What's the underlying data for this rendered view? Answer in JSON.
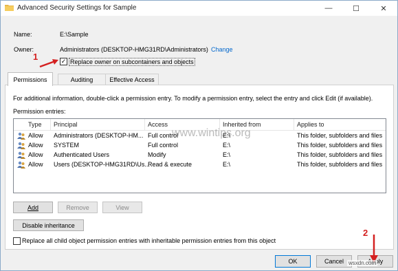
{
  "window": {
    "title": "Advanced Security Settings for Sample",
    "controls": {
      "minimize": "—",
      "maximize": "☐",
      "close": "✕"
    }
  },
  "info": {
    "name_label": "Name:",
    "name_value": "E:\\Sample",
    "owner_label": "Owner:",
    "owner_value": "Administrators (DESKTOP-HMG31RD\\Administrators)",
    "change_link": "Change",
    "replace_owner_label": "Replace owner on subcontainers and objects",
    "replace_owner_checked": true
  },
  "tabs": [
    {
      "label": "Permissions",
      "active": true
    },
    {
      "label": "Auditing",
      "active": false
    },
    {
      "label": "Effective Access",
      "active": false
    }
  ],
  "permissions": {
    "info_text": "For additional information, double-click a permission entry. To modify a permission entry, select the entry and click Edit (if available).",
    "entries_label": "Permission entries:",
    "columns": [
      "Type",
      "Principal",
      "Access",
      "Inherited from",
      "Applies to"
    ],
    "rows": [
      {
        "type": "Allow",
        "principal": "Administrators (DESKTOP-HM...",
        "access": "Full control",
        "inherited": "E:\\",
        "applies": "This folder, subfolders and files"
      },
      {
        "type": "Allow",
        "principal": "SYSTEM",
        "access": "Full control",
        "inherited": "E:\\",
        "applies": "This folder, subfolders and files"
      },
      {
        "type": "Allow",
        "principal": "Authenticated Users",
        "access": "Modify",
        "inherited": "E:\\",
        "applies": "This folder, subfolders and files"
      },
      {
        "type": "Allow",
        "principal": "Users (DESKTOP-HMG31RD\\Us...",
        "access": "Read & execute",
        "inherited": "E:\\",
        "applies": "This folder, subfolders and files"
      }
    ],
    "buttons": {
      "add": "Add",
      "remove": "Remove",
      "view": "View"
    },
    "disable_inheritance": "Disable inheritance",
    "replace_child_label": "Replace all child object permission entries with inheritable permission entries from this object",
    "replace_child_checked": false
  },
  "footer": {
    "ok": "OK",
    "cancel": "Cancel",
    "apply": "Apply"
  },
  "annotations": {
    "step1": "1",
    "step2": "2",
    "color": "#d42020"
  },
  "watermarks": {
    "center": "www.wintips.org",
    "corner": "wsxdn.com"
  }
}
